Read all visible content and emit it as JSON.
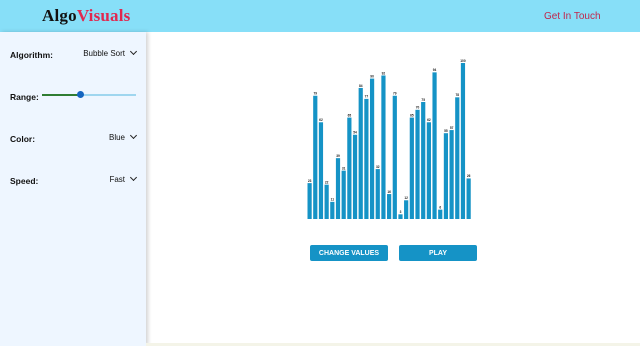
{
  "header": {
    "logo_part1": "Algo",
    "logo_part2": "Visuals",
    "contact_link": "Get In Touch"
  },
  "sidebar": {
    "algorithm": {
      "label": "Algorithm:",
      "value": "Bubble Sort"
    },
    "range": {
      "label": "Range:",
      "value_fraction": 0.4
    },
    "color": {
      "label": "Color:",
      "value": "Blue"
    },
    "speed": {
      "label": "Speed:",
      "value": "Fast"
    }
  },
  "buttons": {
    "change_values": "CHANGE VALUES",
    "play": "PLAY"
  },
  "colors": {
    "bar": "#1593c6",
    "nav": "#87dff8",
    "accent": "#e0284f"
  },
  "chart_data": {
    "type": "bar",
    "values": [
      23,
      79,
      62,
      22,
      11,
      39,
      31,
      65,
      54,
      84,
      77,
      90,
      32,
      92,
      16,
      79,
      3,
      12,
      65,
      70,
      75,
      62,
      94,
      6,
      55,
      57,
      78,
      100,
      26
    ],
    "ylim": [
      0,
      100
    ]
  }
}
